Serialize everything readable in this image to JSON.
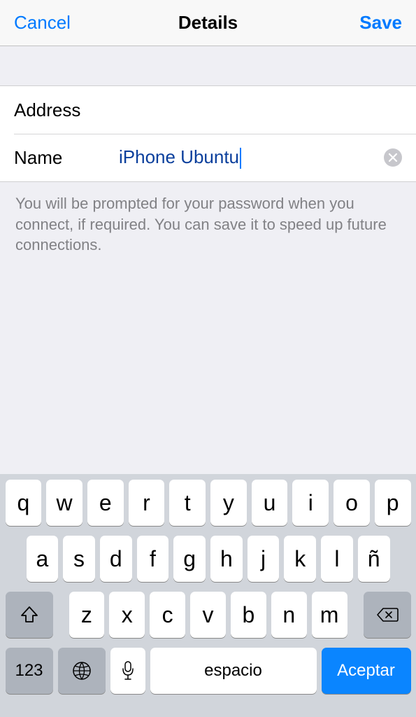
{
  "nav": {
    "cancel": "Cancel",
    "title": "Details",
    "save": "Save"
  },
  "form": {
    "address": {
      "label": "Address",
      "value": ""
    },
    "name": {
      "label": "Name",
      "value": "iPhone Ubuntu"
    }
  },
  "note": "You will be prompted for your password when you connect, if required. You can save it to speed up future connections.",
  "keyboard": {
    "row1": [
      "q",
      "w",
      "e",
      "r",
      "t",
      "y",
      "u",
      "i",
      "o",
      "p"
    ],
    "row2": [
      "a",
      "s",
      "d",
      "f",
      "g",
      "h",
      "j",
      "k",
      "l",
      "ñ"
    ],
    "row3": [
      "z",
      "x",
      "c",
      "v",
      "b",
      "n",
      "m"
    ],
    "num": "123",
    "space": "espacio",
    "accept": "Aceptar"
  }
}
